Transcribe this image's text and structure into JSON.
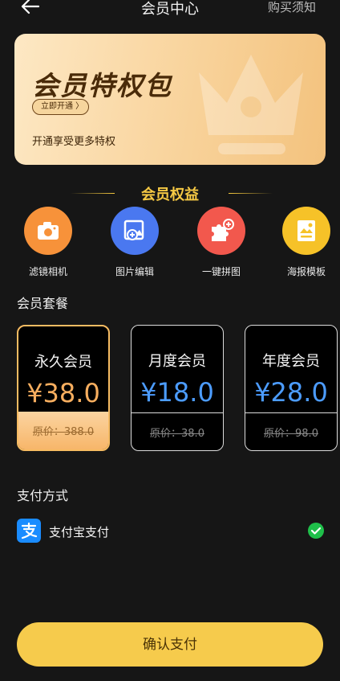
{
  "header": {
    "title": "会员中心",
    "right_link": "购买须知"
  },
  "banner": {
    "title": "会员特权包",
    "button_label": "立即开通 〉",
    "subtitle": "开通享受更多特权"
  },
  "benefits": {
    "title": "会员权益",
    "items": [
      {
        "label": "滤镜相机",
        "icon": "camera-icon",
        "color": "#f7923a"
      },
      {
        "label": "图片编辑",
        "icon": "image-edit-icon",
        "color": "#4a78f0"
      },
      {
        "label": "一键拼图",
        "icon": "puzzle-icon",
        "color": "#f2584d"
      },
      {
        "label": "海报模板",
        "icon": "poster-icon",
        "color": "#f6c228"
      }
    ]
  },
  "plans": {
    "title": "会员套餐",
    "items": [
      {
        "name": "永久会员",
        "price": "¥38.0",
        "original": "原价：388.0",
        "selected": true
      },
      {
        "name": "月度会员",
        "price": "¥18.0",
        "original": "原价：38.0",
        "selected": false
      },
      {
        "name": "年度会员",
        "price": "¥28.0",
        "original": "原价：98.0",
        "selected": false
      }
    ]
  },
  "payment": {
    "title": "支付方式",
    "method_label": "支付宝支付",
    "method_icon": "alipay-icon",
    "status_icon": "check-circle-icon"
  },
  "confirm": {
    "label": "确认支付"
  },
  "colors": {
    "background": "#161616",
    "accent_gold": "#f6cb4c",
    "price_selected": "#f7ae5f",
    "price_blue": "#4c9cff",
    "check_green": "#1fbf4a"
  }
}
